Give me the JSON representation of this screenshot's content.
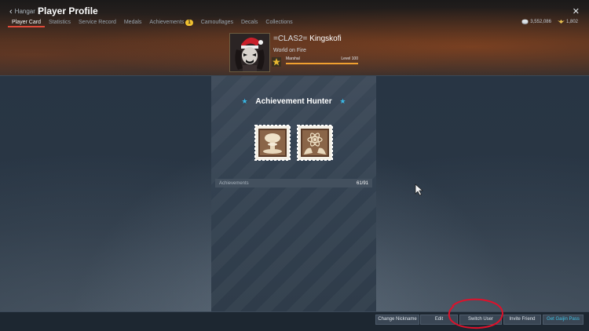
{
  "topbar": {
    "back_label": "Hangar",
    "title": "Player Profile",
    "tabs": [
      {
        "label": "Player Card",
        "active": true
      },
      {
        "label": "Statistics"
      },
      {
        "label": "Service Record"
      },
      {
        "label": "Medals"
      },
      {
        "label": "Achievements",
        "badge": "1"
      },
      {
        "label": "Camouflages"
      },
      {
        "label": "Decals"
      },
      {
        "label": "Collections"
      }
    ],
    "silver_lions": "3,552,086",
    "golden_eagles": "1,802"
  },
  "profile": {
    "clan_tag": "=CLAS2=",
    "nickname": "Kingskofi",
    "title": "World on Fire",
    "rank_name": "Marshal",
    "level": "Level 100",
    "level_progress": 1.0
  },
  "panel": {
    "title": "Achievement Hunter",
    "achievements_label": "Achievements",
    "achievements_count": "61/91",
    "stamps": [
      "mushroom-cloud-icon",
      "atom-hands-icon"
    ]
  },
  "buttons": {
    "change_nickname": "Change Nickname",
    "edit": "Edit",
    "switch_user": "Switch User",
    "invite_friend": "Invite Friend",
    "get_gaijin_pass": "Get Gaijin Pass"
  },
  "colors": {
    "accent_tab": "#e04a3a",
    "star": "#39b8e6",
    "gaijin_pass": "#41c2e6",
    "annotation": "#e0102a"
  }
}
